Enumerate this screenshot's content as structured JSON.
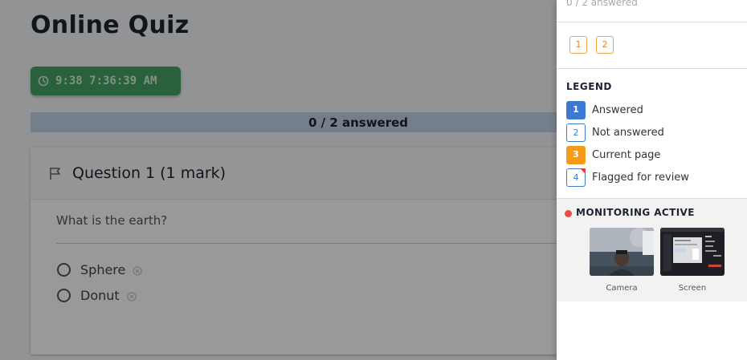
{
  "quiz": {
    "title": "Online Quiz",
    "timer": "9:38 7:36:39 AM",
    "progress_text": "0 / 2 answered",
    "progress_fraction": 0
  },
  "question": {
    "title": "Question 1 (1 mark)",
    "text": "What is the earth?",
    "options": [
      "Sphere",
      "Donut"
    ]
  },
  "drawer": {
    "progress_text": "0 / 2 answered",
    "nav_buttons": [
      "1",
      "2"
    ],
    "legend_title": "LEGEND",
    "legend": [
      {
        "sample": "1",
        "label": "Answered"
      },
      {
        "sample": "2",
        "label": "Not answered"
      },
      {
        "sample": "3",
        "label": "Current page"
      },
      {
        "sample": "4",
        "label": "Flagged for review"
      }
    ],
    "monitoring_title": "MONITORING ACTIVE",
    "camera_label": "Camera",
    "screen_label": "Screen"
  },
  "colors": {
    "timer_bg": "#43a263",
    "answered": "#3b7ad0",
    "current": "#f59a1b",
    "flag": "#e43d3d",
    "monitor_dot": "#ec4a4a"
  }
}
